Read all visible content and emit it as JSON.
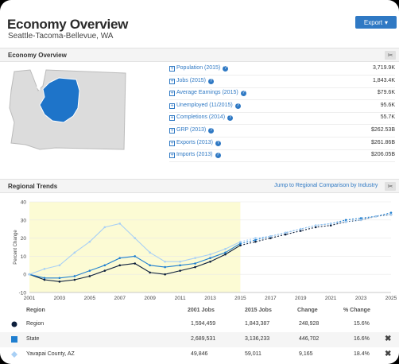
{
  "header": {
    "title": "Economy Overview",
    "subtitle": "Seattle-Tacoma-Bellevue, WA",
    "export_label": "Export",
    "export_caret": "▾"
  },
  "overview": {
    "section_label": "Economy Overview",
    "tool_icon": "scissors-icon",
    "stats": [
      {
        "label": "Population (2015)",
        "value": "3,719.9K"
      },
      {
        "label": "Jobs (2015)",
        "value": "1,843.4K"
      },
      {
        "label": "Average Earnings (2015)",
        "value": "$79.6K"
      },
      {
        "label": "Unemployed (11/2015)",
        "value": "95.6K"
      },
      {
        "label": "Completions (2014)",
        "value": "55.7K"
      },
      {
        "label": "GRP (2013)",
        "value": "$262.53B"
      },
      {
        "label": "Exports (2013)",
        "value": "$261.86B"
      },
      {
        "label": "Imports (2013)",
        "value": "$206.05B"
      }
    ]
  },
  "trends": {
    "section_label": "Regional Trends",
    "link_label": "Jump to Regional Comparison by Industry",
    "tool_icon": "scissors-icon"
  },
  "chart_data": {
    "type": "line",
    "ylabel": "Percent Change",
    "ylim": [
      -10,
      40
    ],
    "yticks": [
      -10,
      0,
      10,
      20,
      30,
      40
    ],
    "xlim": [
      2001,
      2025
    ],
    "xticks": [
      "2001",
      "2003",
      "2005",
      "2007",
      "2009",
      "2011",
      "2013",
      "2015",
      "2017",
      "2019",
      "2021",
      "2023",
      "2025"
    ],
    "highlight_range": [
      2001,
      2015
    ],
    "series": [
      {
        "name": "Region",
        "color": "#0d1f3c",
        "x": [
          2001,
          2002,
          2003,
          2004,
          2005,
          2006,
          2007,
          2008,
          2009,
          2010,
          2011,
          2012,
          2013,
          2014,
          2015,
          2016,
          2017,
          2018,
          2019,
          2020,
          2021,
          2022,
          2023,
          2024,
          2025
        ],
        "y": [
          0,
          -3,
          -4,
          -3,
          -1,
          2,
          5,
          6,
          1,
          0,
          2,
          4,
          7,
          11,
          16,
          18,
          20,
          22,
          24,
          26,
          27,
          29,
          30,
          32,
          33
        ]
      },
      {
        "name": "State",
        "color": "#1f7fd0",
        "x": [
          2001,
          2002,
          2003,
          2004,
          2005,
          2006,
          2007,
          2008,
          2009,
          2010,
          2011,
          2012,
          2013,
          2014,
          2015,
          2016,
          2017,
          2018,
          2019,
          2020,
          2021,
          2022,
          2023,
          2024,
          2025
        ],
        "y": [
          0,
          -2,
          -2,
          -1,
          2,
          5,
          9,
          10,
          5,
          4,
          5,
          6,
          9,
          12,
          17,
          19,
          21,
          23,
          25,
          27,
          28,
          30,
          31,
          32,
          34
        ]
      },
      {
        "name": "Yavapai County, AZ",
        "color": "#a9d0f5",
        "x": [
          2001,
          2002,
          2003,
          2004,
          2005,
          2006,
          2007,
          2008,
          2009,
          2010,
          2011,
          2012,
          2013,
          2014,
          2015,
          2016,
          2017,
          2018,
          2019,
          2020,
          2021,
          2022,
          2023,
          2024,
          2025
        ],
        "y": [
          0,
          3,
          5,
          12,
          18,
          26,
          28,
          20,
          12,
          7,
          7,
          9,
          11,
          14,
          18,
          20,
          21,
          23,
          25,
          27,
          28,
          29,
          30,
          32,
          33
        ]
      }
    ]
  },
  "table": {
    "headers": {
      "region": "Region",
      "jobs2001": "2001 Jobs",
      "jobs2015": "2015 Jobs",
      "change": "Change",
      "pct": "% Change"
    },
    "rows": [
      {
        "region": "Region",
        "jobs2001": "1,594,459",
        "jobs2015": "1,843,387",
        "change": "248,928",
        "pct": "15.6%",
        "marker": "circle",
        "color": "#0d1f3c"
      },
      {
        "region": "State",
        "jobs2001": "2,689,531",
        "jobs2015": "3,136,233",
        "change": "446,702",
        "pct": "16.6%",
        "marker": "square",
        "color": "#1f7fd0",
        "removable": "✖"
      },
      {
        "region": "Yavapai County, AZ",
        "jobs2001": "49,846",
        "jobs2015": "59,011",
        "change": "9,165",
        "pct": "18.4%",
        "marker": "diamond",
        "color": "#a9d0f5",
        "removable": "✖"
      }
    ]
  }
}
